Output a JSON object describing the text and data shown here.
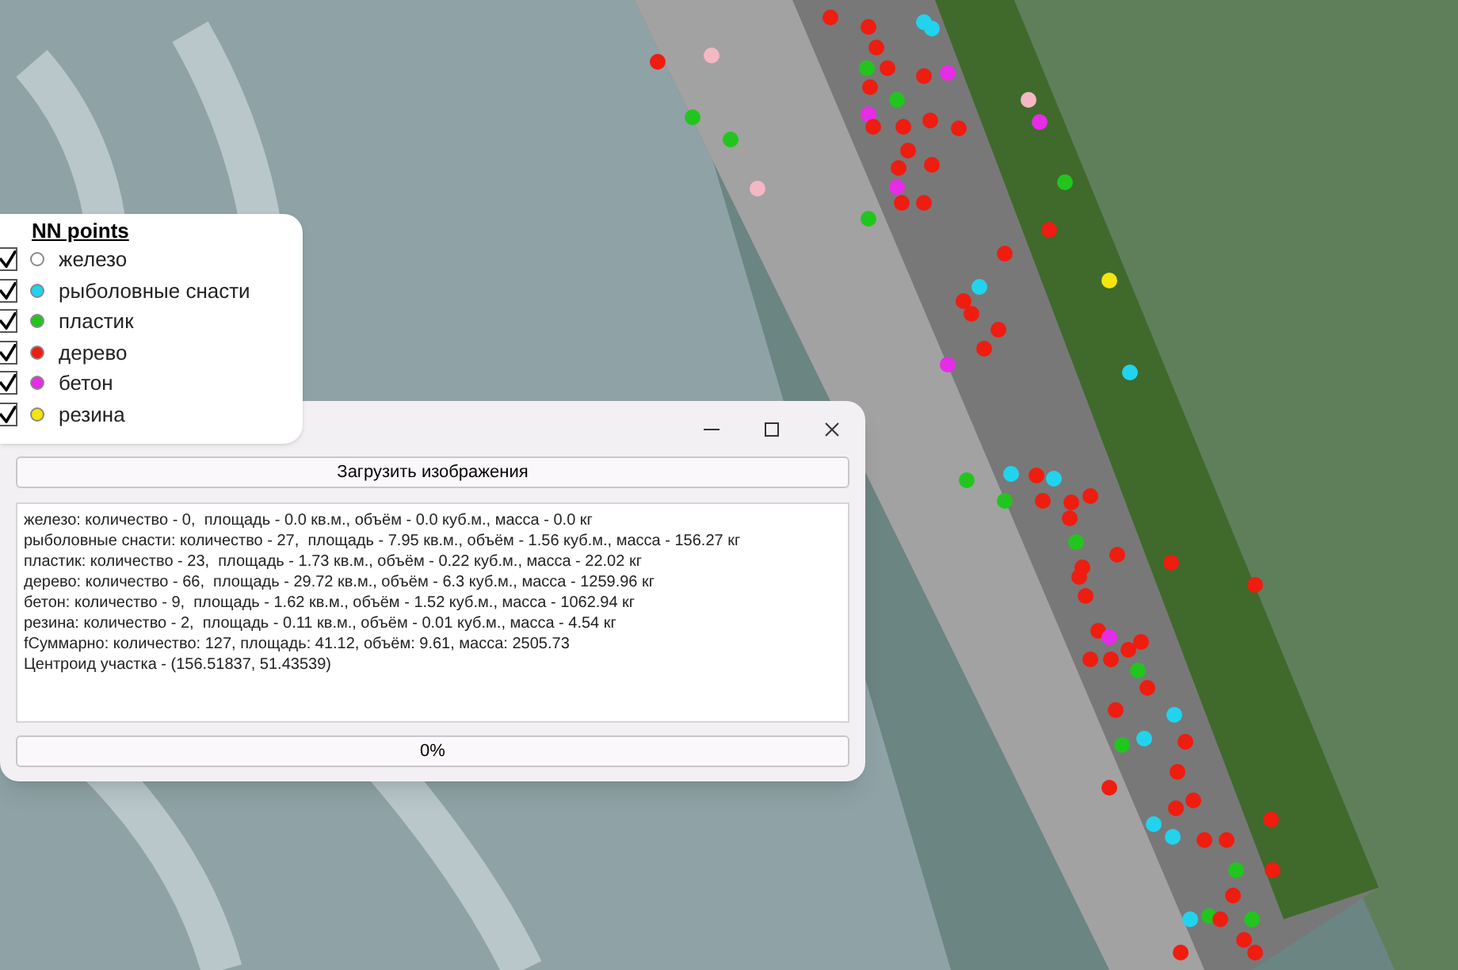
{
  "legend": {
    "title": "NN points",
    "items": [
      {
        "label": "железо",
        "checked": true,
        "color": "#ffffff"
      },
      {
        "label": "рыболовные снасти",
        "checked": true,
        "color": "#22d3ee"
      },
      {
        "label": "пластик",
        "checked": true,
        "color": "#22c51e"
      },
      {
        "label": "дерево",
        "checked": true,
        "color": "#ef1c10"
      },
      {
        "label": "бетон",
        "checked": true,
        "color": "#e62ce6"
      },
      {
        "label": "резина",
        "checked": true,
        "color": "#f5e50a"
      }
    ]
  },
  "dialog": {
    "load_button": "Загрузить изображения",
    "output_lines": [
      "железо: количество - 0,  площадь - 0.0 кв.м., объём - 0.0 куб.м., масса - 0.0 кг",
      "рыболовные снасти: количество - 27,  площадь - 7.95 кв.м., объём - 1.56 куб.м., масса - 156.27 кг",
      "пластик: количество - 23,  площадь - 1.73 кв.м., объём - 0.22 куб.м., масса - 22.02 кг",
      "дерево: количество - 66,  площадь - 29.72 кв.м., объём - 6.3 куб.м., масса - 1259.96 кг",
      "бетон: количество - 9,  площадь - 1.62 кв.м., объём - 1.52 куб.м., масса - 1062.94 кг",
      "резина: количество - 2,  площадь - 0.11 кв.м., объём - 0.01 куб.м., масса - 4.54 кг",
      "fСуммарно: количество: 127, площадь: 41.12, объём: 9.61, масса: 2505.73",
      "Центроид участка - (156.51837, 51.43539)"
    ],
    "progress": {
      "label": "0%",
      "level": 0
    }
  }
}
